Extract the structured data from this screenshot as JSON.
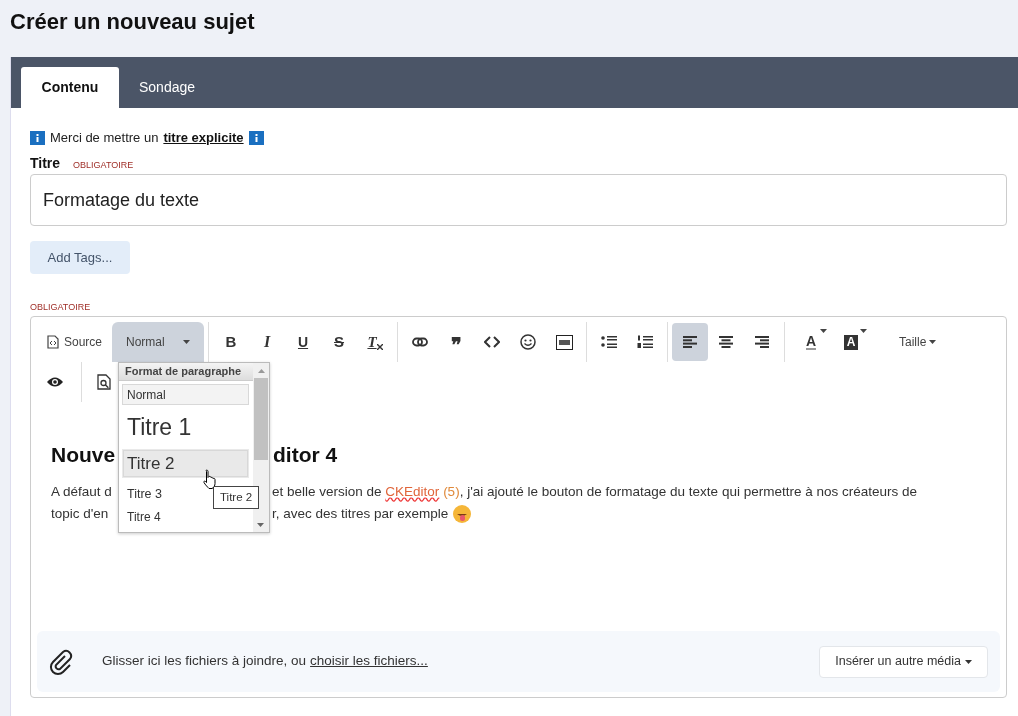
{
  "page_title": "Créer un nouveau sujet",
  "tabs": [
    {
      "label": "Contenu",
      "selected": true
    },
    {
      "label": "Sondage",
      "selected": false
    }
  ],
  "notice": {
    "text": "Merci de mettre un",
    "link": "titre explicite"
  },
  "title_field": {
    "label": "Titre",
    "required": "OBLIGATOIRE",
    "value": "Formatage du texte"
  },
  "tags_button": "Add Tags...",
  "editor": {
    "required": "OBLIGATOIRE",
    "toolbar": [
      [
        {
          "kind": "source",
          "label": "Source"
        },
        {
          "kind": "format",
          "label": "Normal",
          "open": true
        }
      ],
      [
        {
          "kind": "bold",
          "glyph": "B"
        },
        {
          "kind": "italic",
          "glyph": "I"
        },
        {
          "kind": "underline",
          "glyph": "U"
        },
        {
          "kind": "strike",
          "glyph": "S"
        },
        {
          "kind": "clear",
          "glyph": "T"
        }
      ],
      [
        {
          "kind": "link"
        },
        {
          "kind": "quote",
          "glyph": "❞"
        },
        {
          "kind": "code"
        },
        {
          "kind": "smiley"
        },
        {
          "kind": "gif"
        }
      ],
      [
        {
          "kind": "bullets"
        },
        {
          "kind": "numbers"
        }
      ],
      [
        {
          "kind": "align-left",
          "selected": true
        },
        {
          "kind": "align-center",
          "selected": false
        },
        {
          "kind": "align-right",
          "selected": false
        }
      ],
      [
        {
          "kind": "text-color",
          "glyph": "A"
        },
        {
          "kind": "back-color",
          "glyph": "A"
        },
        {
          "kind": "size",
          "label": "Taille"
        }
      ],
      [
        {
          "kind": "preview"
        }
      ],
      [
        {
          "kind": "find"
        }
      ]
    ],
    "format_menu": {
      "title": "Format de paragraphe",
      "options": [
        {
          "label": "Normal",
          "kind": "normal",
          "selected": true,
          "hovered": false
        },
        {
          "label": "Titre 1",
          "kind": "h1",
          "selected": false,
          "hovered": false
        },
        {
          "label": "Titre 2",
          "kind": "h2",
          "selected": false,
          "hovered": true
        },
        {
          "label": "Titre 3",
          "kind": "h3",
          "selected": false,
          "hovered": false
        },
        {
          "label": "Titre 4",
          "kind": "h4",
          "selected": false,
          "hovered": false
        }
      ]
    },
    "tooltip": "Titre 2",
    "heading": {
      "left": "Nouve",
      "right": "ditor 4"
    },
    "paragraph": [
      {
        "left": "A défaut d",
        "right": "et belle version de",
        "link": "CKEditor",
        "count": "(5)",
        "rest": ", j'ai ajouté le bouton de formatage du texte qui permettre à nos créateurs de"
      },
      {
        "left": "topic d'en",
        "right": "r, avec des titres par exemple",
        "emoji": true
      }
    ]
  },
  "attachments": {
    "text": "Glisser ici les fichiers à joindre, ou",
    "link": "choisir les fichiers...",
    "media_button": "Insérer un autre média"
  }
}
